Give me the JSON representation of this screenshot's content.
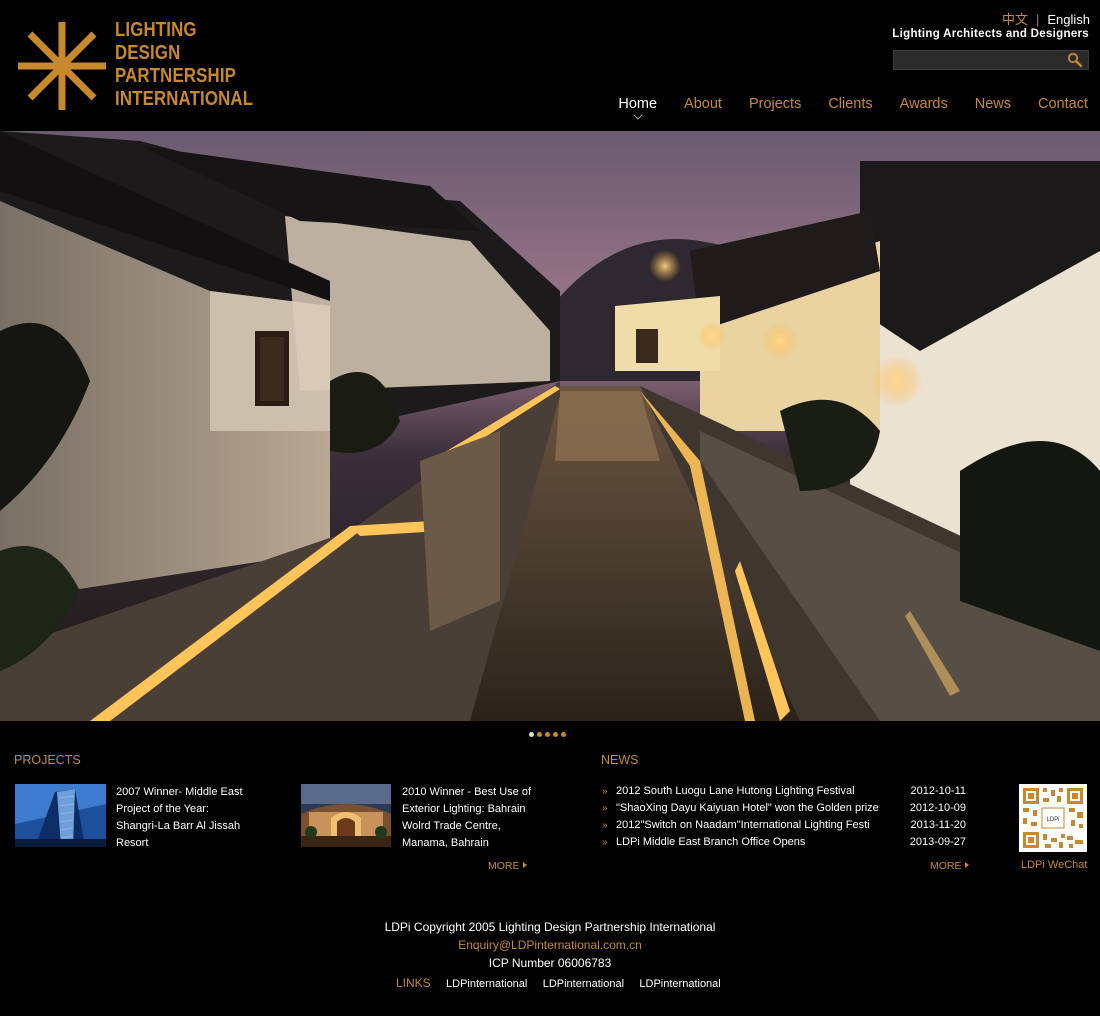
{
  "brand": {
    "logo_lines": [
      "LIGHTING",
      "DESIGN",
      "PARTNERSHIP",
      "INTERNATIONAL"
    ],
    "accent_color": "#c8882c",
    "tagline": "Lighting Architects and Designers"
  },
  "language": {
    "zh": "中文",
    "separator": "|",
    "en": "English"
  },
  "search": {
    "placeholder": "",
    "icon": "search-icon"
  },
  "nav": {
    "items": [
      {
        "label": "Home",
        "active": true
      },
      {
        "label": "About"
      },
      {
        "label": "Projects"
      },
      {
        "label": "Clients"
      },
      {
        "label": "Awards"
      },
      {
        "label": "News"
      },
      {
        "label": "Contact"
      }
    ]
  },
  "slider": {
    "count": 5,
    "active_index": 0
  },
  "projects": {
    "title": "PROJECTS",
    "items": [
      {
        "text": "2007 Winner- Middle East Project of the Year: Shangri-La Barr Al Jissah Resort"
      },
      {
        "text": "2010 Winner - Best Use of Exterior Lighting: Bahrain Wolrd Trade Centre, Manama, Bahrain"
      }
    ],
    "more": "MORE"
  },
  "news": {
    "title": "NEWS",
    "items": [
      {
        "title": "2012 South Luogu Lane Hutong Lighting Festival",
        "date": "2012-10-11"
      },
      {
        "title": "\"ShaoXing Dayu Kaiyuan Hotel\" won the Golden prize",
        "date": "2012-10-09"
      },
      {
        "title": "2012\"Switch on Naadam\"International Lighting Festi",
        "date": "2013-11-20"
      },
      {
        "title": "LDPi Middle East Branch Office Opens",
        "date": "2013-09-27"
      }
    ],
    "more": "MORE",
    "arrow": "»"
  },
  "wechat": {
    "label": "LDPi WeChat",
    "qr_text": "LDPi"
  },
  "footer": {
    "copyright": "LDPi Copyright 2005 Lighting Design Partnership International",
    "email": "Enquiry@LDPinternational.com.cn",
    "icp": "ICP Number 06006783",
    "links_label": "LINKS",
    "links": [
      "LDPinternational",
      "LDPinternational",
      "LDPinternational"
    ]
  }
}
